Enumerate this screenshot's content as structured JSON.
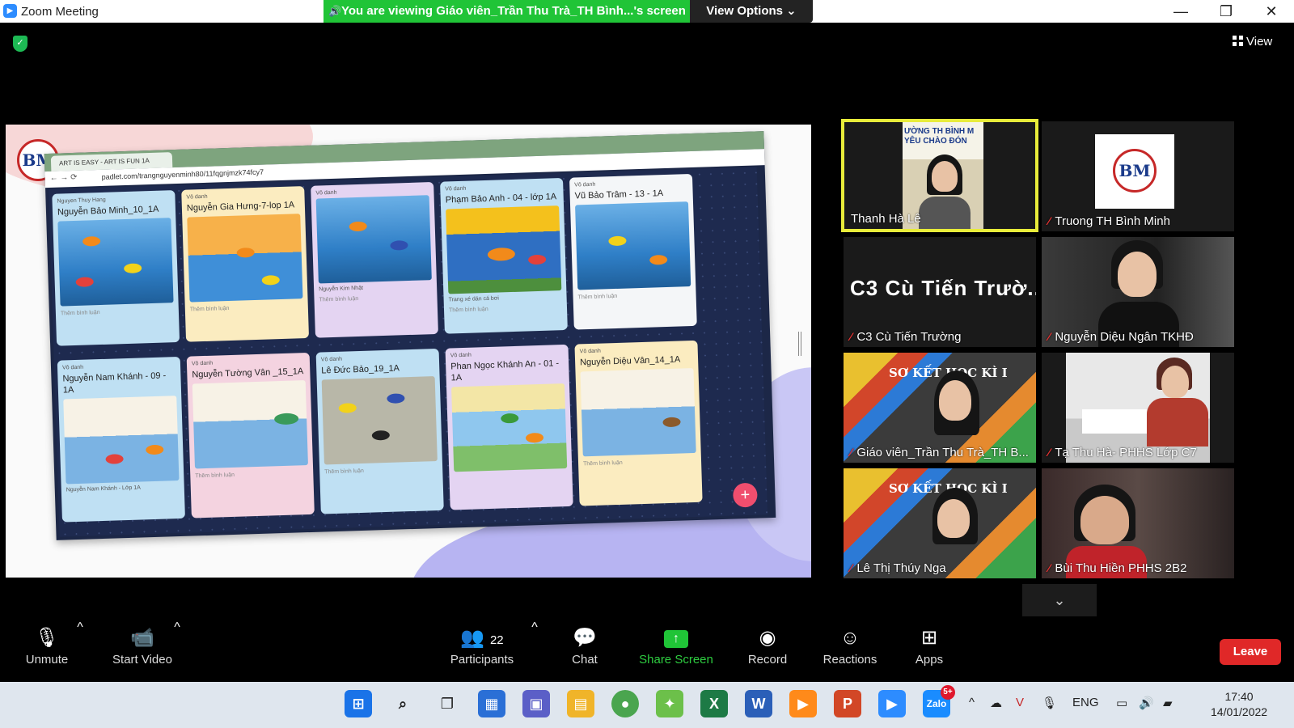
{
  "titlebar": {
    "app_title": "Zoom Meeting",
    "share_banner": "You are viewing Giáo viên_Trần Thu Trà_TH Bình...'s screen",
    "view_options": "View Options",
    "minimize": "—",
    "maximize": "❐",
    "close": "✕"
  },
  "meeting": {
    "view_label": "View"
  },
  "shared_screen": {
    "logo_text": "BM",
    "tab_title": "ART IS EASY - ART IS FUN 1A",
    "url": "padlet.com/trangnguyenminh80/11fqgnjmzk74fcy7",
    "cards": [
      {
        "author": "Nguyen Thuy Hang",
        "title": "Nguyễn Bảo Minh_10_1A",
        "caption": "",
        "meta": "Thêm bình luận"
      },
      {
        "author": "Vô danh",
        "title": "Nguyễn Gia Hưng-7-lop 1A",
        "caption": "",
        "meta": "Thêm bình luận"
      },
      {
        "author": "Vô danh",
        "title": "",
        "caption": "Nguyễn Kim Nhật",
        "meta": "Thêm bình luận"
      },
      {
        "author": "Vô danh",
        "title": "Phạm Bảo Anh - 04 - lớp 1A",
        "caption": "Trang xé dán cá bơi",
        "meta": "Thêm bình luận"
      },
      {
        "author": "Vô danh",
        "title": "Vũ Bảo Trâm - 13 - 1A",
        "caption": "",
        "meta": "Thêm bình luận"
      },
      {
        "author": "Vô danh",
        "title": "Nguyễn Nam Khánh - 09 - 1A",
        "caption": "Nguyễn Nam Khánh - Lớp 1A",
        "meta": ""
      },
      {
        "author": "Vô danh",
        "title": "Nguyễn Tường Vân _15_1A",
        "caption": "",
        "meta": "Thêm bình luận"
      },
      {
        "author": "Vô danh",
        "title": "Lê Đức Bảo_19_1A",
        "caption": "",
        "meta": "Thêm bình luận"
      },
      {
        "author": "Vô danh",
        "title": "Phan Ngọc Khánh An - 01 - 1A",
        "caption": "",
        "meta": ""
      },
      {
        "author": "Vô danh",
        "title": "Nguyễn Diệu Vân_14_1A",
        "caption": "",
        "meta": "Thêm bình luận"
      }
    ],
    "fab": "+"
  },
  "gallery": [
    {
      "name": "Thanh Hà Lê",
      "muted": false,
      "banner": "ƯỜNG TH BÌNH M YÊU CHÀO ĐÓN"
    },
    {
      "name": "Truong TH Bình Minh",
      "muted": true,
      "logo": "BM"
    },
    {
      "name": "C3 Cù Tiến Trường",
      "muted": true,
      "big": "C3 Cù Tiến Trườ..."
    },
    {
      "name": "Nguyễn Diệu Ngân TKHĐ",
      "muted": true
    },
    {
      "name": "Giáo viên_Trần Thu Trà_TH B...",
      "muted": true,
      "bg_text": "SƠ KẾT HỌC KÌ I"
    },
    {
      "name": "Tạ Thu Hà- PHHS Lớp C7",
      "muted": true
    },
    {
      "name": "Lê Thị Thúy Nga",
      "muted": true,
      "bg_text": "SƠ KẾT HỌC KÌ I"
    },
    {
      "name": "Bùi Thu Hiền PHHS 2B2",
      "muted": true
    }
  ],
  "controls": {
    "unmute": "Unmute",
    "start_video": "Start Video",
    "participants": "Participants",
    "participants_count": "22",
    "chat": "Chat",
    "share_screen": "Share Screen",
    "record": "Record",
    "reactions": "Reactions",
    "apps": "Apps",
    "leave": "Leave"
  },
  "taskbar": {
    "lang": "ENG",
    "time": "17:40",
    "date": "14/01/2022",
    "zalo_badge": "5+"
  }
}
